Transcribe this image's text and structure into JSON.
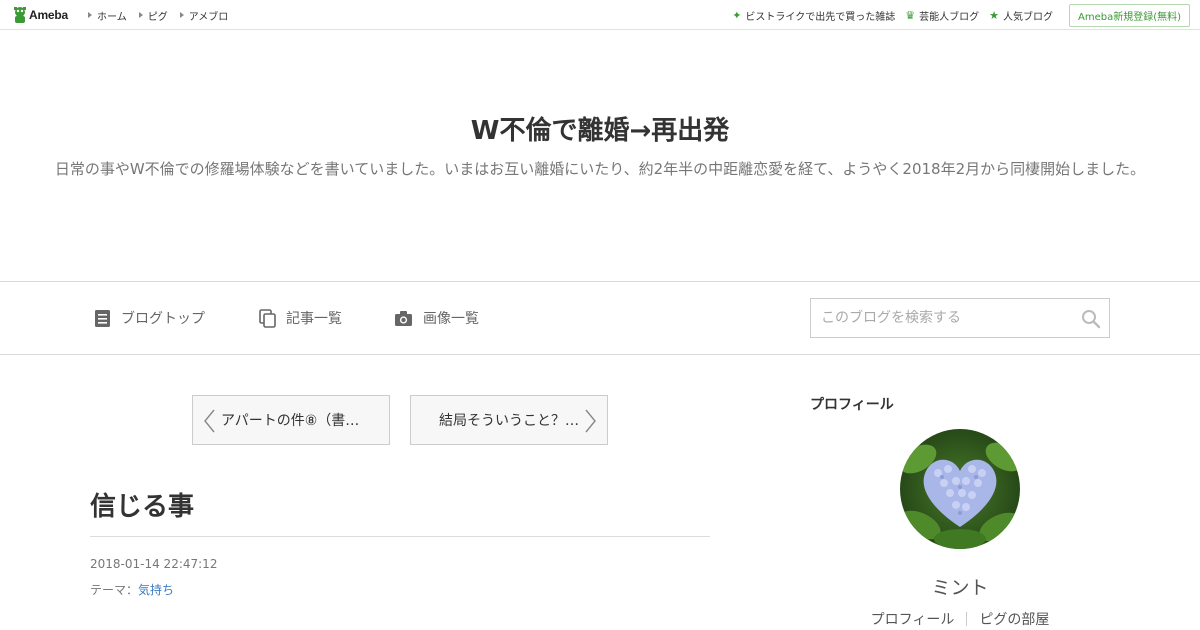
{
  "topbar": {
    "logo_text": "Ameba",
    "nav": [
      "ホーム",
      "ピグ",
      "アメブロ"
    ],
    "right_links": [
      {
        "icon": "sparkle-icon",
        "label": "ビストライクで出先で買った雑誌"
      },
      {
        "icon": "crown-icon",
        "label": "芸能人ブログ"
      },
      {
        "icon": "star-icon",
        "label": "人気ブログ"
      }
    ],
    "register_label": "Ameba新規登録(無料)"
  },
  "header": {
    "title": "W不倫で離婚→再出発",
    "description": "日常の事やW不倫での修羅場体験などを書いていました。いまはお互い離婚にいたり、約2年半の中距離恋愛を経て、ようやく2018年2月から同棲開始しました。"
  },
  "navbar": {
    "items": [
      {
        "icon": "document-icon",
        "label": "ブログトップ"
      },
      {
        "icon": "copy-icon",
        "label": "記事一覧"
      },
      {
        "icon": "camera-icon",
        "label": "画像一覧"
      }
    ],
    "search_placeholder": "このブログを検索する"
  },
  "pager": {
    "prev_label": "アパートの件⑧（書…",
    "next_label": "結局そういうこと？…"
  },
  "entry": {
    "title": "信じる事",
    "date": "2018-01-14 22:47:12",
    "theme_prefix": "テーマ：",
    "theme": "気持ち"
  },
  "sidebar": {
    "heading": "プロフィール",
    "name": "ミント",
    "links": [
      "プロフィール",
      "ピグの部屋"
    ]
  },
  "colors": {
    "ameba_green": "#3b9a35",
    "link_blue": "#3a7bbf",
    "border": "#d9d9d9"
  }
}
